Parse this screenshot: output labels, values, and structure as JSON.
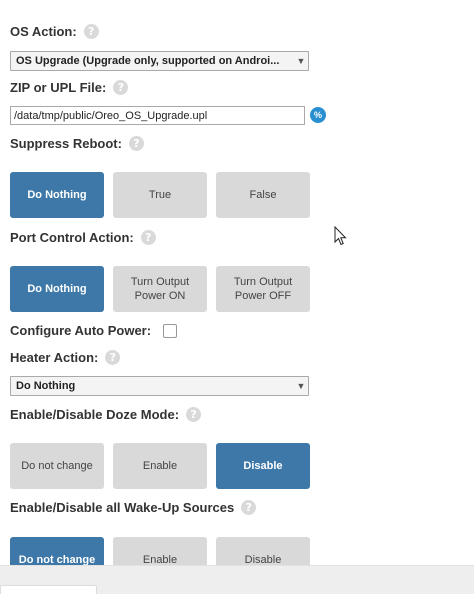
{
  "os_action": {
    "label": "OS Action:",
    "selected": "OS Upgrade (Upgrade only, supported on Androi..."
  },
  "zip_file": {
    "label": "ZIP or UPL File:",
    "value": "/data/tmp/public/Oreo_OS_Upgrade.upl",
    "action_icon": "globe-icon"
  },
  "suppress_reboot": {
    "label": "Suppress Reboot:",
    "options": [
      "Do Nothing",
      "True",
      "False"
    ],
    "selected": "Do Nothing"
  },
  "port_control": {
    "label": "Port Control Action:",
    "options": [
      "Do Nothing",
      "Turn Output Power ON",
      "Turn Output Power OFF"
    ],
    "selected": "Do Nothing"
  },
  "auto_power": {
    "label": "Configure Auto Power:",
    "checked": false
  },
  "heater_action": {
    "label": "Heater Action:",
    "selected": "Do Nothing"
  },
  "doze_mode": {
    "label": "Enable/Disable Doze Mode:",
    "options": [
      "Do not change",
      "Enable",
      "Disable"
    ],
    "selected": "Disable"
  },
  "wakeup_sources": {
    "label": "Enable/Disable all Wake-Up Sources",
    "options": [
      "Do not change",
      "Enable",
      "Disable"
    ],
    "selected": "Do not change"
  },
  "help_icon": "?",
  "colors": {
    "active_button": "#3d78a8",
    "inactive_button": "#d9d9d9",
    "globe": "#2a8fd0"
  }
}
